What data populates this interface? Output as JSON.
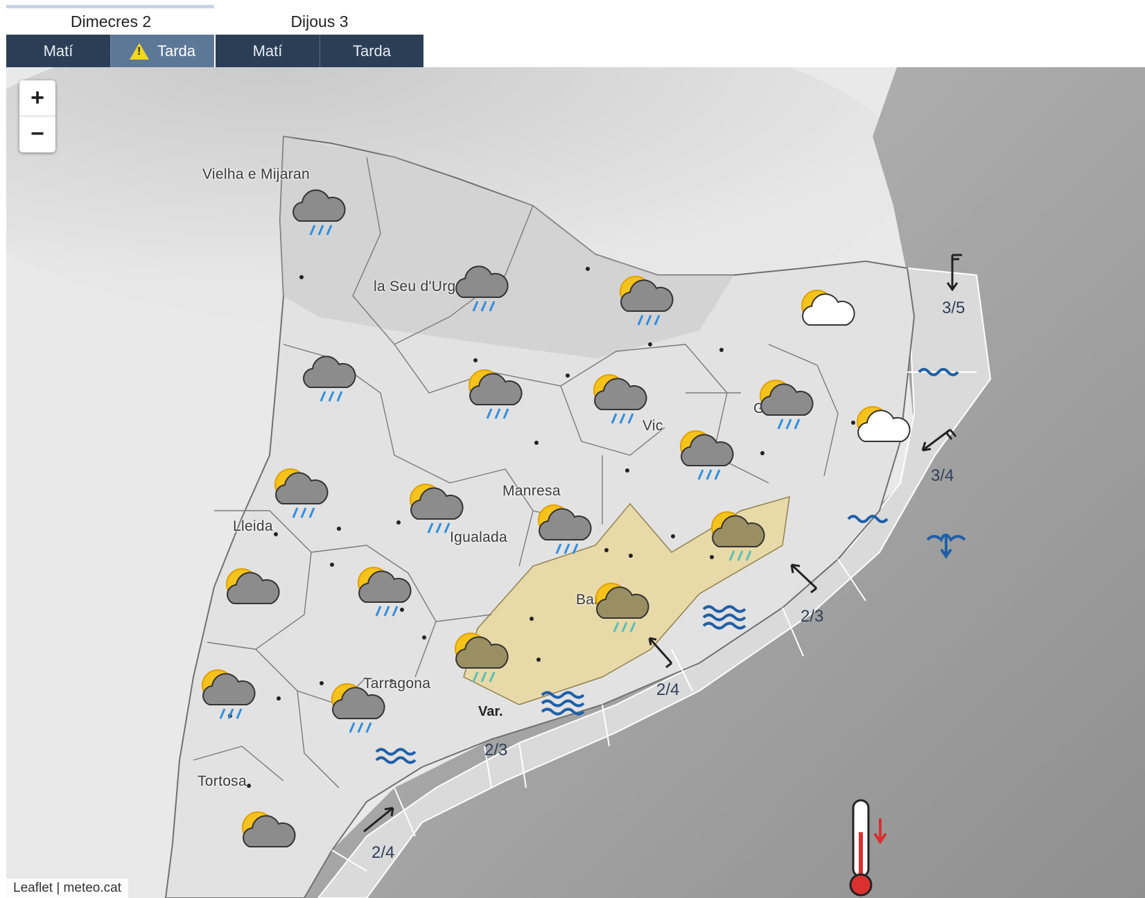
{
  "days": [
    {
      "label": "Dimecres 2",
      "periods": [
        {
          "label": "Matí",
          "warning": false,
          "active": false
        },
        {
          "label": "Tarda",
          "warning": true,
          "active": true
        }
      ]
    },
    {
      "label": "Dijous 3",
      "periods": [
        {
          "label": "Matí",
          "warning": false,
          "active": false
        },
        {
          "label": "Tarda",
          "warning": false,
          "active": false
        }
      ]
    }
  ],
  "zoom": {
    "in_label": "+",
    "out_label": "−"
  },
  "towns": [
    "Vielha e Mijaran",
    "la Seu d'Urgell",
    "Vic",
    "Girona",
    "Manresa",
    "Lleida",
    "Igualada",
    "Barcelona",
    "Tarragona",
    "Tortosa"
  ],
  "weather_icons": [
    "rain-cloud-icon",
    "sun-rain-cloud-icon",
    "sun-cloud-icon",
    "sun-storm-rain-icon"
  ],
  "sea_state": [
    "3/5",
    "3/4",
    "2/3",
    "2/4",
    "2/3",
    "2/4"
  ],
  "variable_label": "Var.",
  "attribution": {
    "leaflet": "Leaflet",
    "separator": "|",
    "source": "meteo.cat"
  },
  "colors": {
    "tab_bg": "#2b3e56",
    "tab_active": "#5d7897",
    "warning_zone": "#e9d9a4",
    "sea_icon": "#1f5fa8",
    "thermometer": "#d93030"
  }
}
